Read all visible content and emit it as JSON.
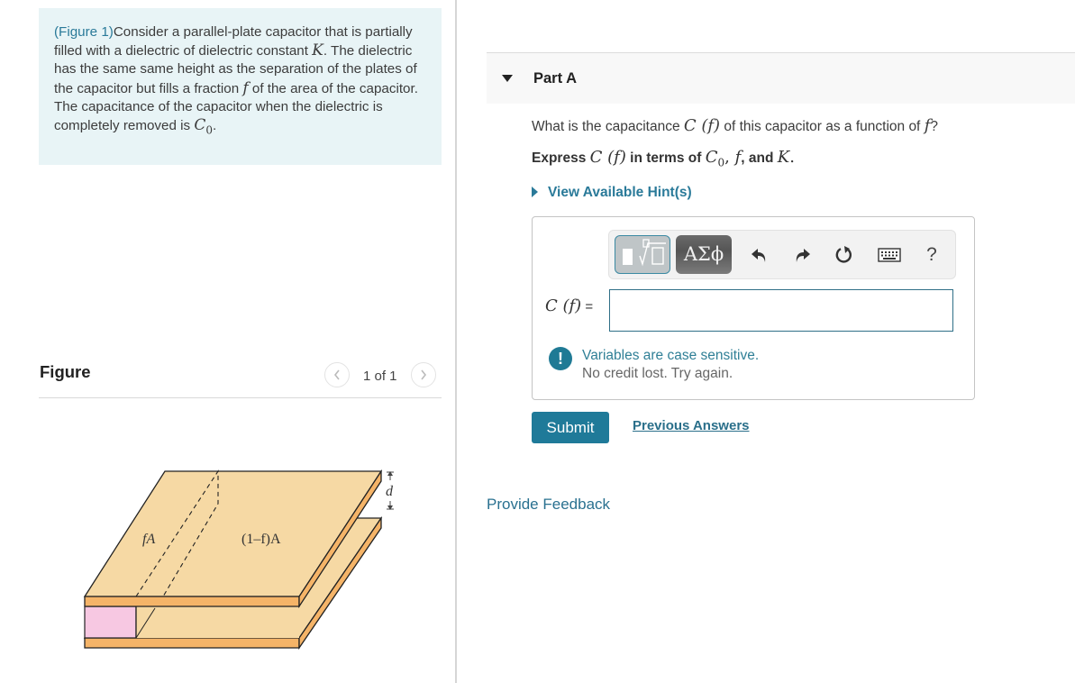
{
  "intro": {
    "figure_link": "(Figure 1)",
    "text_1": "Consider a parallel-plate capacitor that is partially filled with a dielectric of dielectric constant ",
    "var_K": "K",
    "text_2": ". The dielectric has the same same height as the separation of the plates of the capacitor but fills a fraction ",
    "var_f": "f",
    "text_3": " of the area of the capacitor. The capacitance of the capacitor when the dielectric is completely removed is ",
    "var_C0_base": "C",
    "var_C0_sub": "0",
    "text_4": "."
  },
  "figure_panel": {
    "title": "Figure",
    "pager": "1 of 1",
    "prev_icon": "chevron-left-icon",
    "next_icon": "chevron-right-icon",
    "labels": {
      "fA": "fA",
      "one_minus_f_A": "(1–f)A",
      "d": "d"
    },
    "colors": {
      "plate_top": "#f6d9a4",
      "plate_edge": "#f5b468",
      "dielectric_front": "#f7c8e2",
      "dielectric_side": "#ee93c8"
    }
  },
  "part": {
    "title": "Part A",
    "question_pre": "What is the capacitance ",
    "question_Cf": "C (f)",
    "question_mid": " of this capacitor as a function of ",
    "question_f": "f",
    "question_end": "?",
    "express_pre": "Express ",
    "express_Cf": "C (f)",
    "express_mid": " in terms of ",
    "express_C": "C",
    "express_C_sub": "0",
    "express_sep1": ", ",
    "express_f": "f",
    "express_sep2": ", and ",
    "express_K": "K",
    "express_end": ".",
    "hints_label": "View Available Hint(s)"
  },
  "answer": {
    "toolbar": {
      "templates_icon": "templates-icon",
      "symbols_label": "ΑΣϕ",
      "undo_icon": "undo-icon",
      "redo_icon": "redo-icon",
      "reset_icon": "reset-icon",
      "keyboard_icon": "keyboard-icon",
      "help_label": "?"
    },
    "label_Cf": "C (f)",
    "label_eq": " =",
    "input_value": "",
    "feedback_icon": "!",
    "feedback_line1": "Variables are case sensitive.",
    "feedback_line2": "No credit lost. Try again."
  },
  "actions": {
    "submit_label": "Submit",
    "previous_answers_label": "Previous Answers",
    "provide_feedback_label": "Provide Feedback"
  },
  "colors": {
    "accent": "#1f7a99",
    "link": "#2a7a99",
    "intro_bg": "#e8f4f6"
  }
}
